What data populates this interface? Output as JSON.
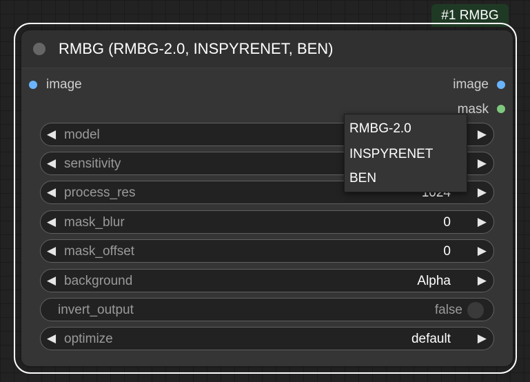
{
  "badge": {
    "text": "#1 RMBG"
  },
  "node": {
    "title": "RMBG (RMBG-2.0, INSPYRENET, BEN)",
    "inputs": [
      {
        "label": "image",
        "color": "#6ab4ff"
      }
    ],
    "outputs": [
      {
        "label": "image",
        "color": "#6ab4ff"
      },
      {
        "label": "mask",
        "color": "#7ec87e"
      }
    ],
    "widgets": [
      {
        "label": "model",
        "value": ""
      },
      {
        "label": "sensitivity",
        "value": ""
      },
      {
        "label": "process_res",
        "value": "1024"
      },
      {
        "label": "mask_blur",
        "value": "0"
      },
      {
        "label": "mask_offset",
        "value": "0"
      },
      {
        "label": "background",
        "value": "Alpha"
      },
      {
        "label": "invert_output",
        "value": "false"
      },
      {
        "label": "optimize",
        "value": "default"
      }
    ]
  },
  "dropdown": {
    "options": [
      "RMBG-2.0",
      "INSPYRENET",
      "BEN"
    ]
  }
}
